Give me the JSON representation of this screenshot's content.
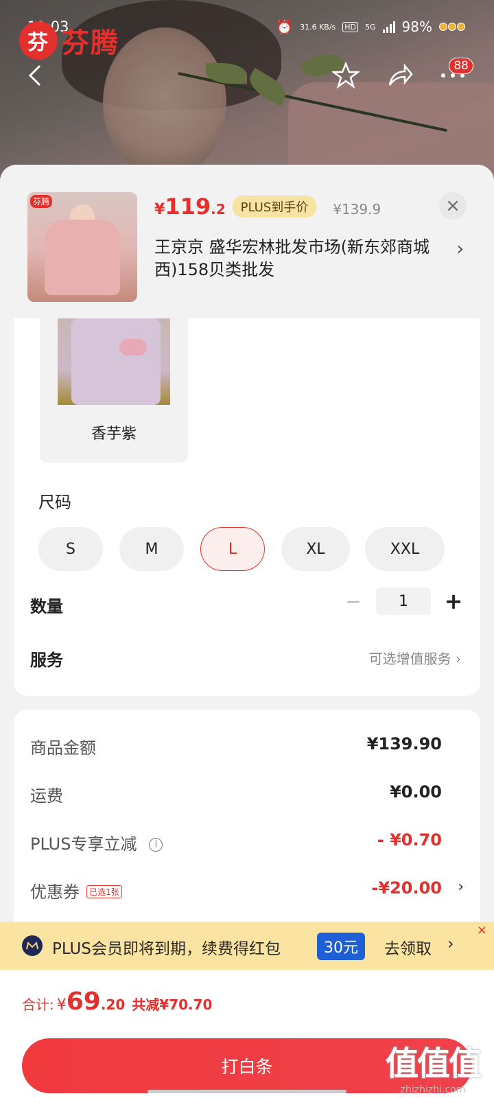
{
  "status": {
    "time": "11:03",
    "net_speed": "31.6 KB/s",
    "hd": "HD",
    "network": "5G",
    "battery": "98%"
  },
  "app": {
    "brand_logo_char": "芬",
    "brand_name": "芬腾",
    "notification_count": "88"
  },
  "product": {
    "thumb_tag": "芬腾",
    "price_currency": "¥",
    "price_integer": "119",
    "price_decimal": ".2",
    "plus_tag": "PLUS到手价",
    "original_price": "¥139.9",
    "shop_name": "王京京  盛华宏林批发市场(新东郊商城西)158贝类批发",
    "close_icon": "×"
  },
  "options": {
    "color_label": "香芋紫",
    "size_title": "尺码",
    "sizes": [
      "S",
      "M",
      "L",
      "XL",
      "XXL"
    ],
    "selected_size": "L",
    "quantity_label": "数量",
    "quantity_value": "1",
    "minus": "−",
    "plus": "+",
    "service_label": "服务",
    "service_value": "可选增值服务 ›"
  },
  "summary": {
    "goods_label": "商品金额",
    "goods_value": "¥139.90",
    "shipping_label": "运费",
    "shipping_value": "¥0.00",
    "plus_discount_label": "PLUS专享立减",
    "plus_discount_value": "- ¥0.70",
    "coupon_label": "优惠券",
    "coupon_tag": "已选1张",
    "coupon_value": "-¥20.00"
  },
  "banner": {
    "text": "PLUS会员即将到期，续费得红包",
    "amount": "30元",
    "cta": "去领取",
    "arrow": "›",
    "close": "×"
  },
  "footer": {
    "total_label": "合计:",
    "total_currency": "¥",
    "total_integer": "69",
    "total_decimal": ".20",
    "total_saved": "共减¥70.70",
    "pay_button": "打白条"
  },
  "watermark": {
    "big": "值值值",
    "small": "zhizhizhi.com"
  },
  "colors": {
    "accent_red": "#e4302c",
    "plus_gold": "#fbe3a2",
    "badge_blue": "#1e5fd6"
  }
}
